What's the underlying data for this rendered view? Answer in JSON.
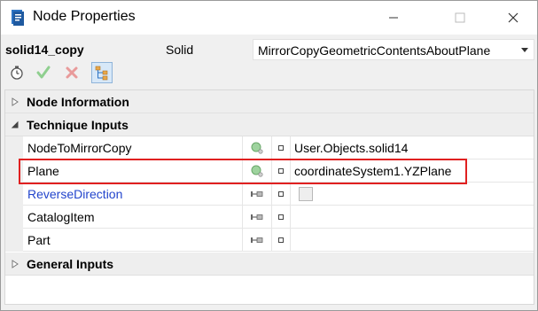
{
  "window": {
    "title": "Node Properties"
  },
  "header": {
    "node_name": "solid14_copy",
    "node_type": "Solid",
    "technique": "MirrorCopyGeometricContentsAboutPlane"
  },
  "sections": {
    "node_information": "Node Information",
    "technique_inputs": "Technique Inputs",
    "general_inputs": "General Inputs"
  },
  "rows": [
    {
      "name": "NodeToMirrorCopy",
      "value": "User.Objects.solid14",
      "icon": "object-picker-icon"
    },
    {
      "name": "Plane",
      "value": "coordinateSystem1.YZPlane",
      "icon": "object-picker-icon"
    },
    {
      "name": "ReverseDirection",
      "value": "",
      "icon": "pin-icon"
    },
    {
      "name": "CatalogItem",
      "value": "",
      "icon": "pin-icon"
    },
    {
      "name": "Part",
      "value": "",
      "icon": "pin-icon"
    }
  ],
  "colors": {
    "highlight": "#e02020",
    "link_blue": "#2244cc",
    "ok_green": "#5cb85c",
    "cancel_red": "#d9534f"
  }
}
